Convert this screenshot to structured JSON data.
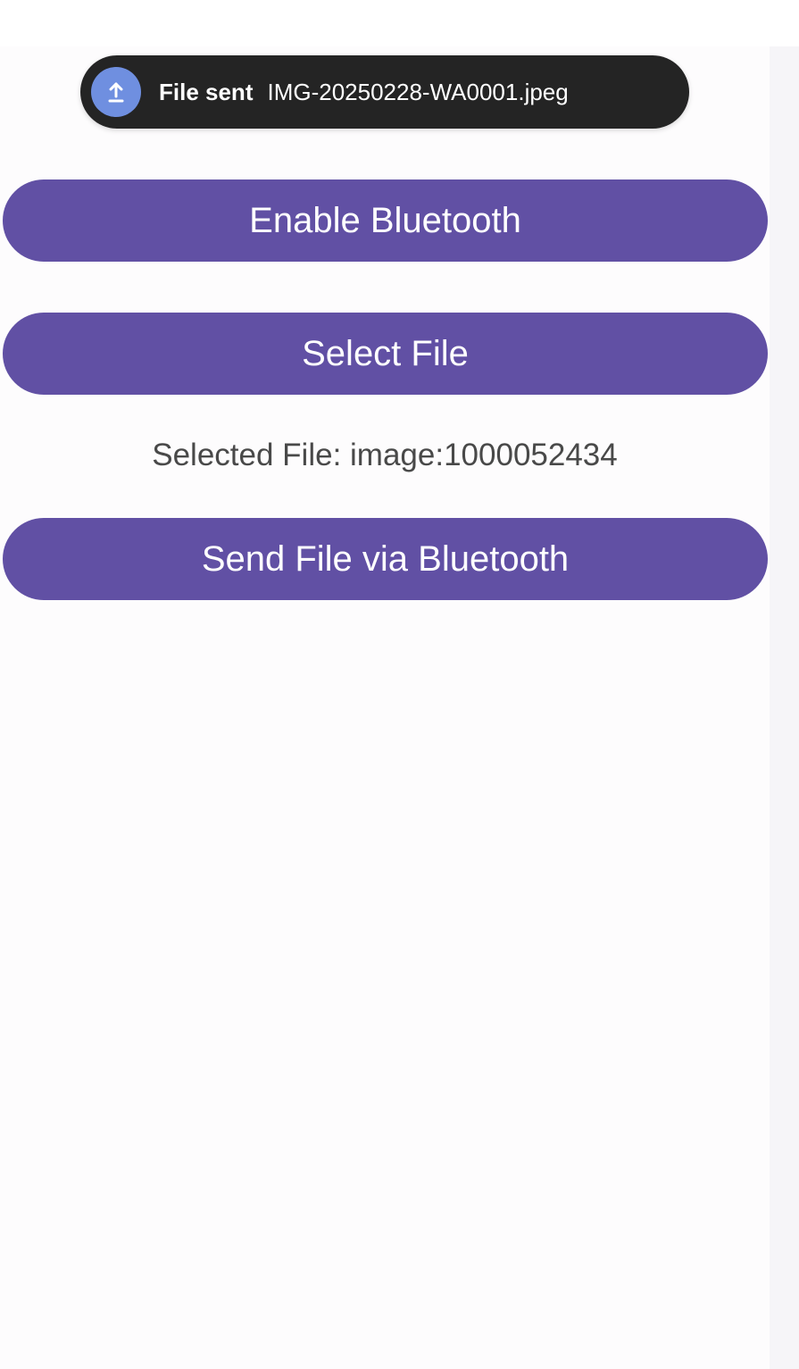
{
  "toast": {
    "icon": "upload-icon",
    "title": "File sent",
    "file_name": "IMG-20250228-WA0001.jpeg"
  },
  "buttons": {
    "enable_bluetooth": "Enable Bluetooth",
    "select_file": "Select File",
    "send_file": "Send File via Bluetooth"
  },
  "selected_file_text": "Selected File: image:1000052434",
  "colors": {
    "button": "#6150a4",
    "toast_background": "#242424",
    "toast_icon": "#6f8fe0"
  }
}
